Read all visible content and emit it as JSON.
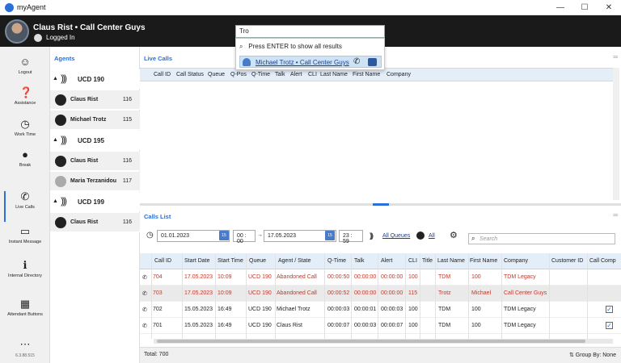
{
  "window": {
    "title": "myAgent",
    "minimize": "—",
    "maximize": "☐",
    "close": "✕"
  },
  "header": {
    "user_name": "Claus Rist • Call Center Guys",
    "status": "Logged In"
  },
  "search": {
    "value": "Tro",
    "hint": "Press ENTER to show all results",
    "result": "Michael Trotz • Call Center Guys"
  },
  "sidebar": {
    "items": [
      {
        "label": "Logout",
        "icon": "logout-icon"
      },
      {
        "label": "Assistance",
        "icon": "help-icon"
      },
      {
        "label": "Work Time",
        "icon": "clock-icon"
      },
      {
        "label": "Break",
        "icon": "break-clock-icon"
      },
      {
        "label": "Live Calls",
        "icon": "phone-icon"
      },
      {
        "label": "Instant Message",
        "icon": "chat-icon"
      },
      {
        "label": "Internal Directory",
        "icon": "info-icon"
      },
      {
        "label": "Attendant Buttons",
        "icon": "grid-icon"
      }
    ],
    "more": "⋯",
    "version": "6.3.88.515"
  },
  "agents": {
    "title": "Agents",
    "groups": [
      {
        "name": "UCD 190",
        "agents": [
          {
            "name": "Claus Rist",
            "ext": "116"
          },
          {
            "name": "Michael Trotz",
            "ext": "115"
          }
        ]
      },
      {
        "name": "UCD 195",
        "agents": [
          {
            "name": "Claus Rist",
            "ext": "116"
          },
          {
            "name": "Maria Terzanidou",
            "ext": "117"
          }
        ]
      },
      {
        "name": "UCD 199",
        "agents": [
          {
            "name": "Claus Rist",
            "ext": "116"
          }
        ]
      }
    ]
  },
  "live_calls": {
    "title": "Live Calls",
    "columns": [
      "Call ID",
      "Call Status",
      "Queue",
      "Q-Pos",
      "Q-Time",
      "Talk",
      "Alert",
      "CLI",
      "Last Name",
      "First Name",
      "Company"
    ]
  },
  "calls_list": {
    "title": "Calls List",
    "start_date": "01.01.2023",
    "start_time": "00 : 00",
    "end_date": "17.05.2023",
    "end_time": "23 : 59",
    "calendar_label": "15",
    "arrow": "→",
    "all_queues": "All Queues",
    "all_agents": "All",
    "search_placeholder": "Search",
    "columns": [
      "Call ID",
      "Start Date",
      "Start Time",
      "Queue",
      "Agent / State",
      "Q-Time",
      "Talk",
      "Alert",
      "CLI",
      "Title",
      "Last Name",
      "First Name",
      "Company",
      "Customer ID",
      "Call Comp"
    ],
    "rows": [
      {
        "id": "704",
        "date": "17.05.2023",
        "time": "10:09",
        "queue": "UCD 190",
        "agent": "Abandoned Call",
        "qtime": "00:00:50",
        "talk": "00:00:00",
        "alert": "00:00:00",
        "cli": "100",
        "title": "",
        "last": "TDM",
        "first": "100",
        "company": "TDM Legacy",
        "customer": "",
        "complete": false,
        "abandoned": true
      },
      {
        "id": "703",
        "date": "17.05.2023",
        "time": "10:09",
        "queue": "UCD 190",
        "agent": "Abandoned Call",
        "qtime": "00:00:52",
        "talk": "00:00:00",
        "alert": "00:00:00",
        "cli": "115",
        "title": "",
        "last": "Trotz",
        "first": "Michael",
        "company": "Call Center Guys",
        "customer": "",
        "complete": false,
        "abandoned": true
      },
      {
        "id": "702",
        "date": "15.05.2023",
        "time": "16:49",
        "queue": "UCD 190",
        "agent": "Michael Trotz",
        "qtime": "00:00:03",
        "talk": "00:00:01",
        "alert": "00:00:03",
        "cli": "100",
        "title": "",
        "last": "TDM",
        "first": "100",
        "company": "TDM Legacy",
        "customer": "",
        "complete": true,
        "abandoned": false
      },
      {
        "id": "701",
        "date": "15.05.2023",
        "time": "16:49",
        "queue": "UCD 190",
        "agent": "Claus Rist",
        "qtime": "00:00:07",
        "talk": "00:00:03",
        "alert": "00:00:07",
        "cli": "100",
        "title": "",
        "last": "TDM",
        "first": "100",
        "company": "TDM Legacy",
        "customer": "",
        "complete": true,
        "abandoned": false
      }
    ],
    "total": "Total: 700",
    "group_by": "Group By: None"
  },
  "colors": {
    "accent": "#2a6fdb",
    "abandoned": "#c0392b",
    "header_bg": "#1a1a1a"
  }
}
